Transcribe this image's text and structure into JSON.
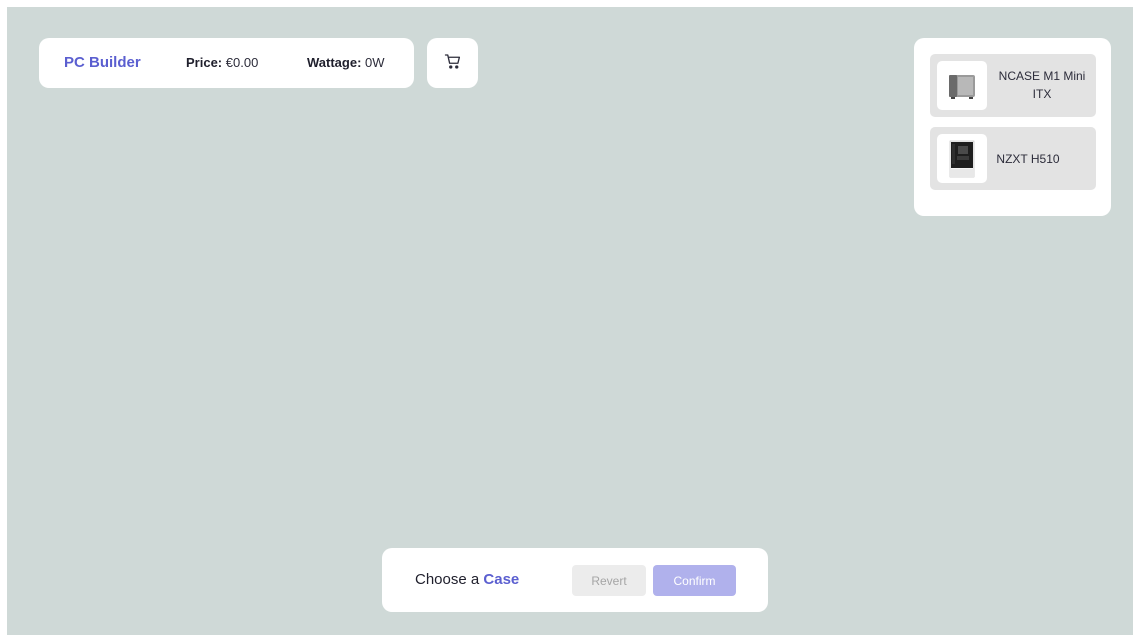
{
  "header": {
    "brand": "PC Builder",
    "price_label": "Price:",
    "price_value": "€0.00",
    "wattage_label": "Wattage:",
    "wattage_value": "0W"
  },
  "cart": {
    "icon": "cart-icon"
  },
  "picker": {
    "items": [
      {
        "label": "NCASE M1 Mini ITX",
        "icon": "case-image"
      },
      {
        "label": "NZXT H510",
        "icon": "case-image"
      }
    ]
  },
  "footer": {
    "prompt_prefix": "Choose a",
    "prompt_category": "Case",
    "revert_label": "Revert",
    "confirm_label": "Confirm"
  },
  "colors": {
    "accent": "#5b5fd0",
    "background": "#cfd9d7",
    "confirm_disabled": "#b0b1ec"
  }
}
